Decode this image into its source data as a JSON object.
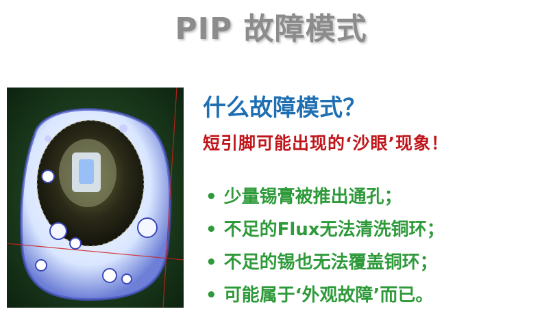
{
  "slide": {
    "title": "PIP 故障模式",
    "heading": "什么故障模式？",
    "subheading": "短引脚可能出现的‘沙眼’现象！",
    "bullet_symbol": "•",
    "bullets": [
      "少量锡膏被推出通孔；",
      "不足的Flux无法清洗铜环；",
      "不足的锡也无法覆盖铜环；",
      "可能属于‘外观故障’而已。"
    ],
    "colors": {
      "title": "#8c8c8c",
      "heading": "#1f6fb2",
      "subheading": "#c0161b",
      "bullets": "#2e9a3a"
    },
    "photo_icon": "solder-joint-micrograph"
  }
}
